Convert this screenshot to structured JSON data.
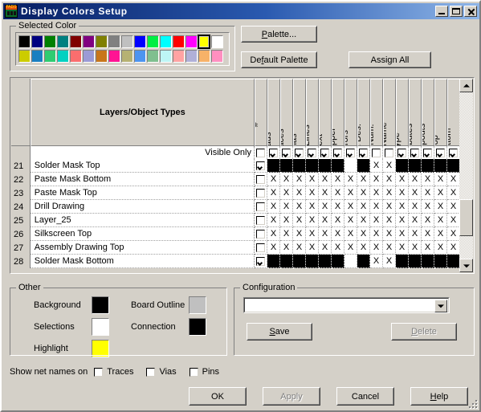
{
  "window": {
    "title": "Display Colors Setup",
    "icon": "pads-app-icon",
    "minimize": "minimize-icon",
    "maximize": "maximize-icon",
    "close": "close-icon"
  },
  "selected_color": {
    "group_label": "Selected Color",
    "selected_index": 14,
    "selected_hex": "#ffff00",
    "row1": [
      "#000000",
      "#000080",
      "#008000",
      "#008080",
      "#800000",
      "#800080",
      "#808000",
      "#808080",
      "#c0c0c0",
      "#0000ff",
      "#00ee44",
      "#00ffff",
      "#ff0000",
      "#ff00ff",
      "#ffff00",
      "#ffffff"
    ],
    "row2": [
      "#cccc00",
      "#1a7fc1",
      "#2ecc71",
      "#00d1c1",
      "#fa6e6e",
      "#9b9bd6",
      "#c8761a",
      "#ff1493",
      "#b6b273",
      "#4d94f0",
      "#7fbf8f",
      "#bdf5f5",
      "#ffa3a3",
      "#b0b0d8",
      "#f7b268",
      "#ff8fc0"
    ]
  },
  "buttons": {
    "palette": "Palette...",
    "palette_mnemonic": "P",
    "default_palette": "Default Palette",
    "default_palette_mnemonic": "f",
    "assign_all": "Assign All"
  },
  "table": {
    "name_header": "Layers/Object Types",
    "columns": [
      "#",
      "Pads",
      "Traces",
      "Vias",
      "2D Lines",
      "Text",
      "Copper",
      "Errors",
      "Ref. Des.",
      "Pin Num.",
      "Net Name",
      "Type",
      "Attributes",
      "Keepouts",
      "Top",
      "Bottom"
    ],
    "visible_only_label": "Visible Only",
    "visible_only": [
      false,
      true,
      true,
      true,
      true,
      true,
      true,
      true,
      true,
      false,
      false,
      true,
      true,
      true,
      true,
      true
    ],
    "rows": [
      {
        "num": "21",
        "name": "Solder Mask Top",
        "checked": true,
        "cells": [
          "black",
          "black",
          "black",
          "black",
          "black",
          "black",
          "white",
          "black",
          "x",
          "x",
          "black",
          "black",
          "black",
          "black",
          "black"
        ]
      },
      {
        "num": "22",
        "name": "Paste Mask Bottom",
        "checked": false,
        "cells": [
          "x",
          "x",
          "x",
          "x",
          "x",
          "x",
          "x",
          "x",
          "x",
          "x",
          "x",
          "x",
          "x",
          "x",
          "x"
        ]
      },
      {
        "num": "23",
        "name": "Paste Mask Top",
        "checked": false,
        "cells": [
          "x",
          "x",
          "x",
          "x",
          "x",
          "x",
          "x",
          "x",
          "x",
          "x",
          "x",
          "x",
          "x",
          "x",
          "x"
        ]
      },
      {
        "num": "24",
        "name": "Drill Drawing",
        "checked": false,
        "cells": [
          "x",
          "x",
          "x",
          "x",
          "x",
          "x",
          "x",
          "x",
          "x",
          "x",
          "x",
          "x",
          "x",
          "x",
          "x"
        ]
      },
      {
        "num": "25",
        "name": "Layer_25",
        "checked": false,
        "cells": [
          "x",
          "x",
          "x",
          "x",
          "x",
          "x",
          "x",
          "x",
          "x",
          "x",
          "x",
          "x",
          "x",
          "x",
          "x"
        ]
      },
      {
        "num": "26",
        "name": "Silkscreen Top",
        "checked": false,
        "cells": [
          "x",
          "x",
          "x",
          "x",
          "x",
          "x",
          "x",
          "x",
          "x",
          "x",
          "x",
          "x",
          "x",
          "x",
          "x"
        ]
      },
      {
        "num": "27",
        "name": "Assembly Drawing Top",
        "checked": false,
        "cells": [
          "x",
          "x",
          "x",
          "x",
          "x",
          "x",
          "x",
          "x",
          "x",
          "x",
          "x",
          "x",
          "x",
          "x",
          "x"
        ]
      },
      {
        "num": "28",
        "name": "Solder Mask Bottom",
        "checked": true,
        "cells": [
          "black",
          "black",
          "black",
          "black",
          "black",
          "black",
          "white",
          "black",
          "x",
          "x",
          "black",
          "black",
          "black",
          "black",
          "black"
        ]
      }
    ],
    "cell_mark": "X"
  },
  "other": {
    "group_label": "Other",
    "background_label": "Background",
    "background_color": "#000000",
    "selections_label": "Selections",
    "selections_color": "#ffffff",
    "highlight_label": "Highlight",
    "highlight_color": "#ffff00",
    "board_outline_label": "Board Outline",
    "board_outline_color": "#c0c0c0",
    "connection_label": "Connection",
    "connection_color": "#000000"
  },
  "configuration": {
    "group_label": "Configuration",
    "combo_value": "",
    "save_label": "Save",
    "save_mnemonic": "S",
    "delete_label": "Delete",
    "delete_mnemonic": "D",
    "delete_enabled": false
  },
  "net_names": {
    "label": "Show net names on",
    "traces_label": "Traces",
    "traces_checked": false,
    "vias_label": "Vias",
    "vias_checked": false,
    "pins_label": "Pins",
    "pins_checked": false
  },
  "dialog_buttons": {
    "ok": "OK",
    "apply": "Apply",
    "apply_enabled": false,
    "cancel": "Cancel",
    "help": "Help",
    "help_mnemonic": "H"
  }
}
